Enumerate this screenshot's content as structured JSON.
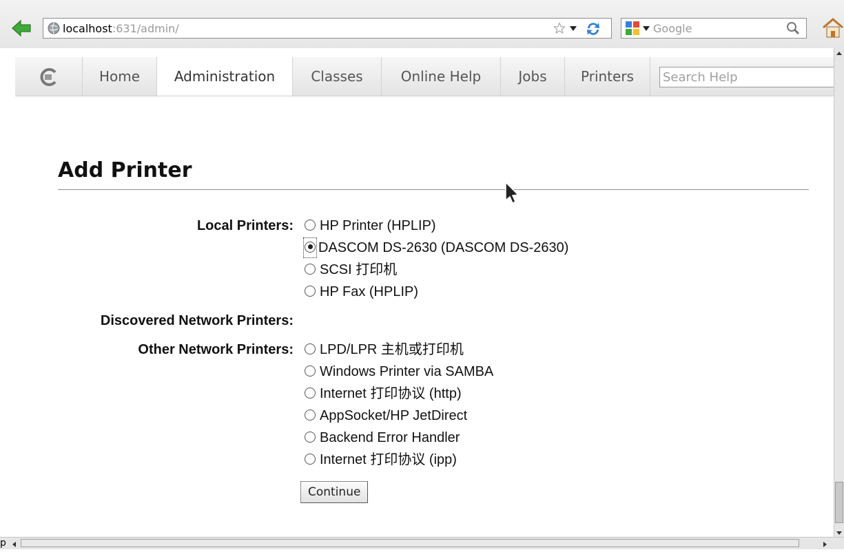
{
  "browser": {
    "url_host": "localhost",
    "url_rest": ":631/admin/",
    "search_engine_placeholder": "Google",
    "status_fragment": "p"
  },
  "nav": {
    "tabs": [
      {
        "label": "Home"
      },
      {
        "label": "Administration",
        "active": true
      },
      {
        "label": "Classes"
      },
      {
        "label": "Online Help"
      },
      {
        "label": "Jobs"
      },
      {
        "label": "Printers"
      }
    ],
    "search_placeholder": "Search Help"
  },
  "page": {
    "title": "Add Printer",
    "local_label": "Local Printers:",
    "local_options": [
      {
        "label": "HP Printer (HPLIP)",
        "checked": false
      },
      {
        "label": "DASCOM DS-2630 (DASCOM DS-2630)",
        "checked": true
      },
      {
        "label": "SCSI 打印机",
        "checked": false
      },
      {
        "label": "HP Fax (HPLIP)",
        "checked": false
      }
    ],
    "discovered_label": "Discovered Network Printers:",
    "other_label": "Other Network Printers:",
    "other_options": [
      {
        "label": "LPD/LPR 主机或打印机",
        "checked": false
      },
      {
        "label": "Windows Printer via SAMBA",
        "checked": false
      },
      {
        "label": "Internet 打印协议 (http)",
        "checked": false
      },
      {
        "label": "AppSocket/HP JetDirect",
        "checked": false
      },
      {
        "label": "Backend Error Handler",
        "checked": false
      },
      {
        "label": "Internet 打印协议 (ipp)",
        "checked": false
      }
    ],
    "continue_label": "Continue"
  },
  "colors": {
    "back_arrow": "#3fa93a",
    "reload": "#2f7fd0"
  },
  "icons": [
    "back-arrow-icon",
    "globe-icon",
    "star-icon",
    "reload-icon",
    "google-icon",
    "magnifier-icon",
    "home-icon",
    "cups-logo-icon",
    "mouse-cursor-icon"
  ]
}
